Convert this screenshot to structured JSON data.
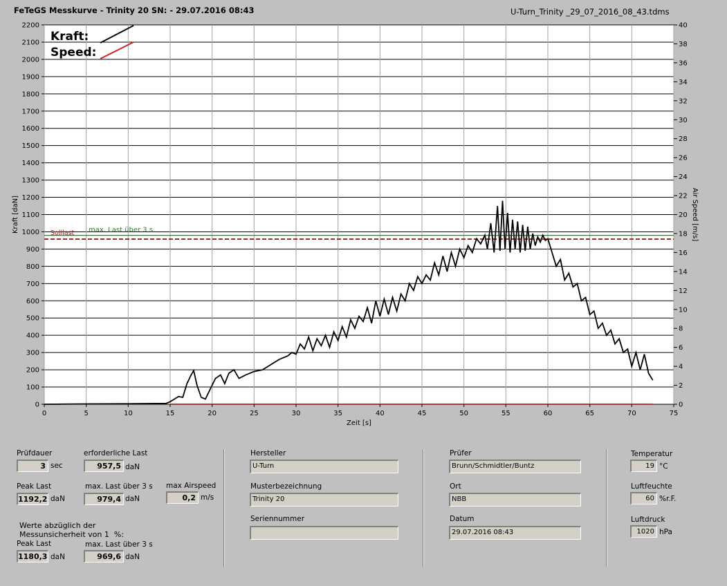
{
  "header": {
    "title": "FeTeGS Messkurve - Trinity 20  SN:  - 29.07.2016 08:43",
    "filename": "U-Turn_Trinity _29_07_2016_08_43.tdms"
  },
  "colors": {
    "kraft": "#000000",
    "speed": "#d42020",
    "max_last": "#2e7d2e",
    "solllast": "#b22222",
    "plot_bg": "#ffffff"
  },
  "chart_data": {
    "type": "line",
    "xlabel": "Zeit [s]",
    "ylabel": "Kraft [daN]",
    "y2label": "Air Speed [m/s]",
    "xlim": [
      0,
      75
    ],
    "ylim": [
      0,
      2200
    ],
    "y2lim": [
      0,
      40
    ],
    "x_ticks": [
      "0",
      "5",
      "10",
      "15",
      "20",
      "25",
      "30",
      "35",
      "40",
      "45",
      "50",
      "55",
      "60",
      "65",
      "70",
      "75"
    ],
    "y_ticks": [
      "0",
      "100",
      "200",
      "300",
      "400",
      "500",
      "600",
      "700",
      "800",
      "900",
      "1000",
      "1100",
      "1200",
      "1300",
      "1400",
      "1500",
      "1600",
      "1700",
      "1800",
      "1900",
      "2000",
      "2100",
      "2200"
    ],
    "y2_ticks": [
      "0",
      "2",
      "4",
      "6",
      "8",
      "10",
      "12",
      "14",
      "16",
      "18",
      "20",
      "22",
      "24",
      "26",
      "28",
      "30",
      "32",
      "34",
      "36",
      "38",
      "40"
    ],
    "grid": true,
    "legend": {
      "position": "top-left",
      "kraft": "Kraft:",
      "speed": "Speed:"
    },
    "reference_lines": [
      {
        "name": "max. Last über  3 s",
        "y": 979.4,
        "style": "solid"
      },
      {
        "name": "Solllast",
        "y": 957.5,
        "style": "dashed"
      }
    ],
    "series": [
      {
        "name": "Kraft",
        "x": [
          0,
          5,
          10,
          14.5,
          15,
          15.5,
          16,
          16.5,
          17,
          17.5,
          17.8,
          18.2,
          18.7,
          19.2,
          19.8,
          20.4,
          21,
          21.5,
          22,
          22.6,
          23.2,
          24,
          25,
          26,
          27,
          28,
          29,
          29.5,
          30,
          30.5,
          31,
          31.5,
          32,
          32.5,
          33,
          33.5,
          34,
          34.5,
          35,
          35.5,
          36,
          36.5,
          37,
          37.5,
          38,
          38.5,
          39,
          39.5,
          40,
          40.5,
          41,
          41.5,
          42,
          42.5,
          43,
          43.5,
          44,
          44.5,
          45,
          45.5,
          46,
          46.5,
          47,
          47.5,
          48,
          48.5,
          49,
          49.5,
          50,
          50.5,
          51,
          51.5,
          52,
          52.5,
          52.8,
          53.2,
          53.6,
          54,
          54.3,
          54.6,
          54.9,
          55.2,
          55.5,
          55.8,
          56.1,
          56.4,
          56.7,
          57,
          57.3,
          57.6,
          57.9,
          58.2,
          58.5,
          58.8,
          59.1,
          59.4,
          59.7,
          60,
          60.5,
          61,
          61.5,
          62,
          62.5,
          63,
          63.5,
          64,
          64.5,
          65,
          65.5,
          66,
          66.5,
          67,
          67.5,
          68,
          68.5,
          69,
          69.5,
          70,
          70.5,
          71,
          71.5,
          72,
          72.5
        ],
        "y": [
          0,
          2,
          3,
          5,
          15,
          30,
          45,
          40,
          120,
          170,
          195,
          110,
          40,
          30,
          90,
          150,
          170,
          120,
          180,
          200,
          150,
          170,
          190,
          200,
          230,
          260,
          280,
          300,
          290,
          350,
          320,
          390,
          310,
          380,
          340,
          400,
          330,
          420,
          370,
          450,
          390,
          490,
          440,
          510,
          480,
          560,
          470,
          600,
          510,
          610,
          520,
          620,
          540,
          640,
          600,
          700,
          660,
          740,
          700,
          750,
          720,
          820,
          750,
          860,
          770,
          880,
          800,
          900,
          850,
          920,
          880,
          960,
          930,
          980,
          900,
          1050,
          880,
          1150,
          890,
          1180,
          900,
          1110,
          880,
          1070,
          900,
          1060,
          880,
          1040,
          890,
          1030,
          900,
          990,
          920,
          970,
          940,
          980,
          950,
          960,
          880,
          800,
          840,
          720,
          760,
          680,
          700,
          600,
          620,
          520,
          540,
          440,
          470,
          400,
          430,
          350,
          380,
          300,
          320,
          220,
          300,
          200,
          290,
          180,
          140
        ]
      },
      {
        "name": "Speed",
        "x": [
          15,
          72.5
        ],
        "y": [
          0,
          0
        ]
      }
    ]
  },
  "panel": {
    "pruefdauer": {
      "label": "Prüfdauer",
      "value": "3",
      "unit": "sec"
    },
    "erforderliche_last": {
      "label": "erforderliche Last",
      "value": "957,5",
      "unit": "daN"
    },
    "peak_last": {
      "label": "Peak Last",
      "value": "1192,2",
      "unit": "daN"
    },
    "max_last": {
      "label": "max. Last über  3 s",
      "value": "979,4",
      "unit": "daN"
    },
    "max_airspeed": {
      "label": "max Airspeed",
      "value": "0,2",
      "unit": "m/s"
    },
    "note": "Werte abzüglich der\nMessunsicherheit von 1  %:",
    "peak_last_corr": {
      "label": "Peak Last",
      "value": "1180,3",
      "unit": "daN"
    },
    "max_last_corr": {
      "label": "max. Last über  3 s",
      "value": "969,6",
      "unit": "daN"
    },
    "hersteller": {
      "label": "Hersteller",
      "value": "U-Turn"
    },
    "musterbezeichnung": {
      "label": "Musterbezeichnung",
      "value": "Trinity 20"
    },
    "seriennummer": {
      "label": "Seriennummer",
      "value": ""
    },
    "pruefer": {
      "label": "Prüfer",
      "value": "Brunn/Schmidtler/Buntz"
    },
    "ort": {
      "label": "Ort",
      "value": "NBB"
    },
    "datum": {
      "label": "Datum",
      "value": "29.07.2016 08:43"
    },
    "temperatur": {
      "label": "Temperatur",
      "value": "19",
      "unit": "°C"
    },
    "luftfeuchte": {
      "label": "Luftfeuchte",
      "value": "60",
      "unit": "%r.F."
    },
    "luftdruck": {
      "label": "Luftdruck",
      "value": "1020",
      "unit": "hPa"
    }
  }
}
